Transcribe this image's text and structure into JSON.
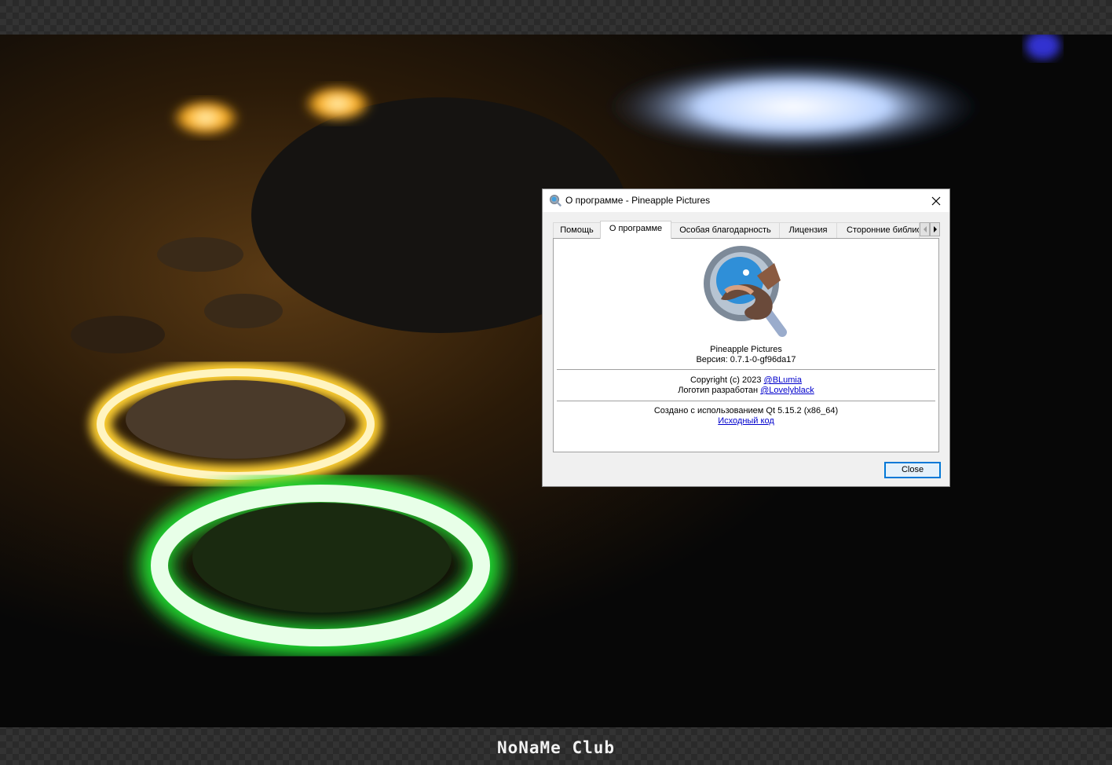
{
  "watermark": "NoNaMe Club",
  "dialog": {
    "title": "О программе - Pineapple Pictures",
    "tabs": [
      {
        "label": "Помощь",
        "active": false
      },
      {
        "label": "О программе",
        "active": true
      },
      {
        "label": "Особая благодарность",
        "active": false
      },
      {
        "label": "Лицензия",
        "active": false
      },
      {
        "label": "Сторонние библио",
        "active": false
      }
    ],
    "app_name": "Pineapple Pictures",
    "version": "Версия: 0.7.1-0-gf96da17",
    "copyright_prefix": "Copyright (c) 2023 ",
    "copyright_link": "@BLumia",
    "logo_prefix": "Логотип разработан ",
    "logo_link": "@Lovelyblack",
    "built_with": "Создано с использованием Qt 5.15.2 (x86_64)",
    "source_link": "Исходный код",
    "close_label": "Close"
  },
  "colors": {
    "accent": "#0078d7",
    "link": "#0000cc"
  }
}
